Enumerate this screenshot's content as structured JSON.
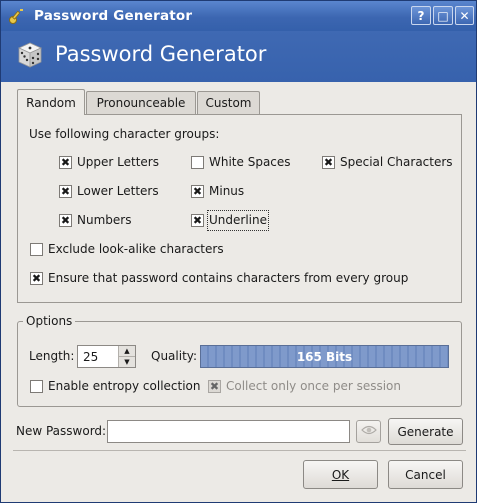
{
  "window": {
    "title": "Password Generator"
  },
  "titlebar_buttons": {
    "help": "?",
    "maximize": "□",
    "close": "✕"
  },
  "header": {
    "title": "Password Generator"
  },
  "tabs": [
    {
      "label": "Random",
      "active": true
    },
    {
      "label": "Pronounceable",
      "active": false
    },
    {
      "label": "Custom",
      "active": false
    }
  ],
  "random_tab": {
    "groups_label": "Use following character groups:",
    "groups": [
      {
        "label": "Upper Letters",
        "checked": true
      },
      {
        "label": "White Spaces",
        "checked": false
      },
      {
        "label": "Special Characters",
        "checked": true
      },
      {
        "label": "Lower Letters",
        "checked": true
      },
      {
        "label": "Minus",
        "checked": true
      },
      {
        "label": "Numbers",
        "checked": true
      },
      {
        "label": "Underline",
        "checked": true
      }
    ],
    "exclude_lookalike": {
      "label": "Exclude look-alike characters",
      "checked": false
    },
    "ensure_every_group": {
      "label": "Ensure that password contains characters from every group",
      "checked": true
    }
  },
  "options": {
    "title": "Options",
    "length_label": "Length:",
    "length_value": "25",
    "quality_label": "Quality:",
    "quality_text": "165 Bits",
    "entropy": {
      "label": "Enable entropy collection",
      "checked": false
    },
    "collect_once": {
      "label": "Collect only once per session",
      "checked": true,
      "disabled": true
    }
  },
  "new_password": {
    "label": "New Password:",
    "value": ""
  },
  "buttons": {
    "generate": "Generate",
    "ok": "OK",
    "cancel": "Cancel"
  },
  "icons": {
    "app": "key-icon",
    "header": "dice-icon",
    "reveal": "eye-icon"
  },
  "colors": {
    "titlebar": "#3c66b1",
    "quality_bar": "#7f9acb"
  }
}
